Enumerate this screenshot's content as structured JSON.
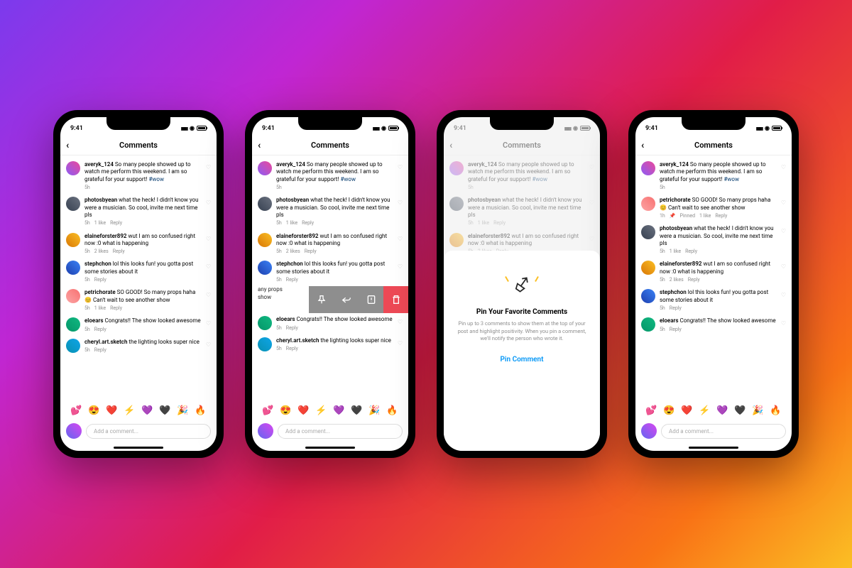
{
  "status_time": "9:41",
  "header_title": "Comments",
  "comments_base": [
    {
      "user": "averyk_124",
      "text": "So many people showed up to watch me perform this weekend. I am so grateful for your support! ",
      "hashtag": "#wow",
      "time": "5h",
      "likes": "",
      "reply": ""
    },
    {
      "user": "photosbyean",
      "text": "what the heck! I didn't know you were a musician. So cool, invite me next time pls",
      "time": "5h",
      "likes": "1 like",
      "reply": "Reply"
    },
    {
      "user": "elaineforster892",
      "text": "wut I am so confused right now :0 what is happening",
      "time": "5h",
      "likes": "2 likes",
      "reply": "Reply"
    },
    {
      "user": "stephchon",
      "text": "lol this looks fun! you gotta post some stories about it",
      "time": "5h",
      "likes": "",
      "reply": "Reply"
    },
    {
      "user": "petrichorate",
      "text": "SO GOOD! So many props haha 😊 Can't wait to see another show",
      "time": "5h",
      "likes": "1 like",
      "reply": "Reply"
    },
    {
      "user": "eloears",
      "text": "Congrats!! The show looked awesome",
      "time": "5h",
      "likes": "",
      "reply": "Reply"
    },
    {
      "user": "cheryl.art.sketch",
      "text": "the lighting looks super nice",
      "time": "5h",
      "likes": "",
      "reply": "Reply"
    }
  ],
  "pinned_comment": {
    "user": "petrichorate",
    "text": "SO GOOD! So many props haha 😊 Can't wait to see another show",
    "time": "1h",
    "pinned": "Pinned",
    "likes": "1 like",
    "reply": "Reply"
  },
  "swipe_partial": "any props\nshow",
  "sheet": {
    "title": "Pin Your Favorite Comments",
    "desc": "Pin up to 3 comments to show them at the top of your post and highlight positivity. When you pin a comment, we'll notify the person who wrote it.",
    "action": "Pin Comment"
  },
  "emoji_list": [
    "💕",
    "😍",
    "❤️",
    "⚡",
    "💜",
    "🖤",
    "🎉",
    "🔥"
  ],
  "input_placeholder": "Add a comment..."
}
